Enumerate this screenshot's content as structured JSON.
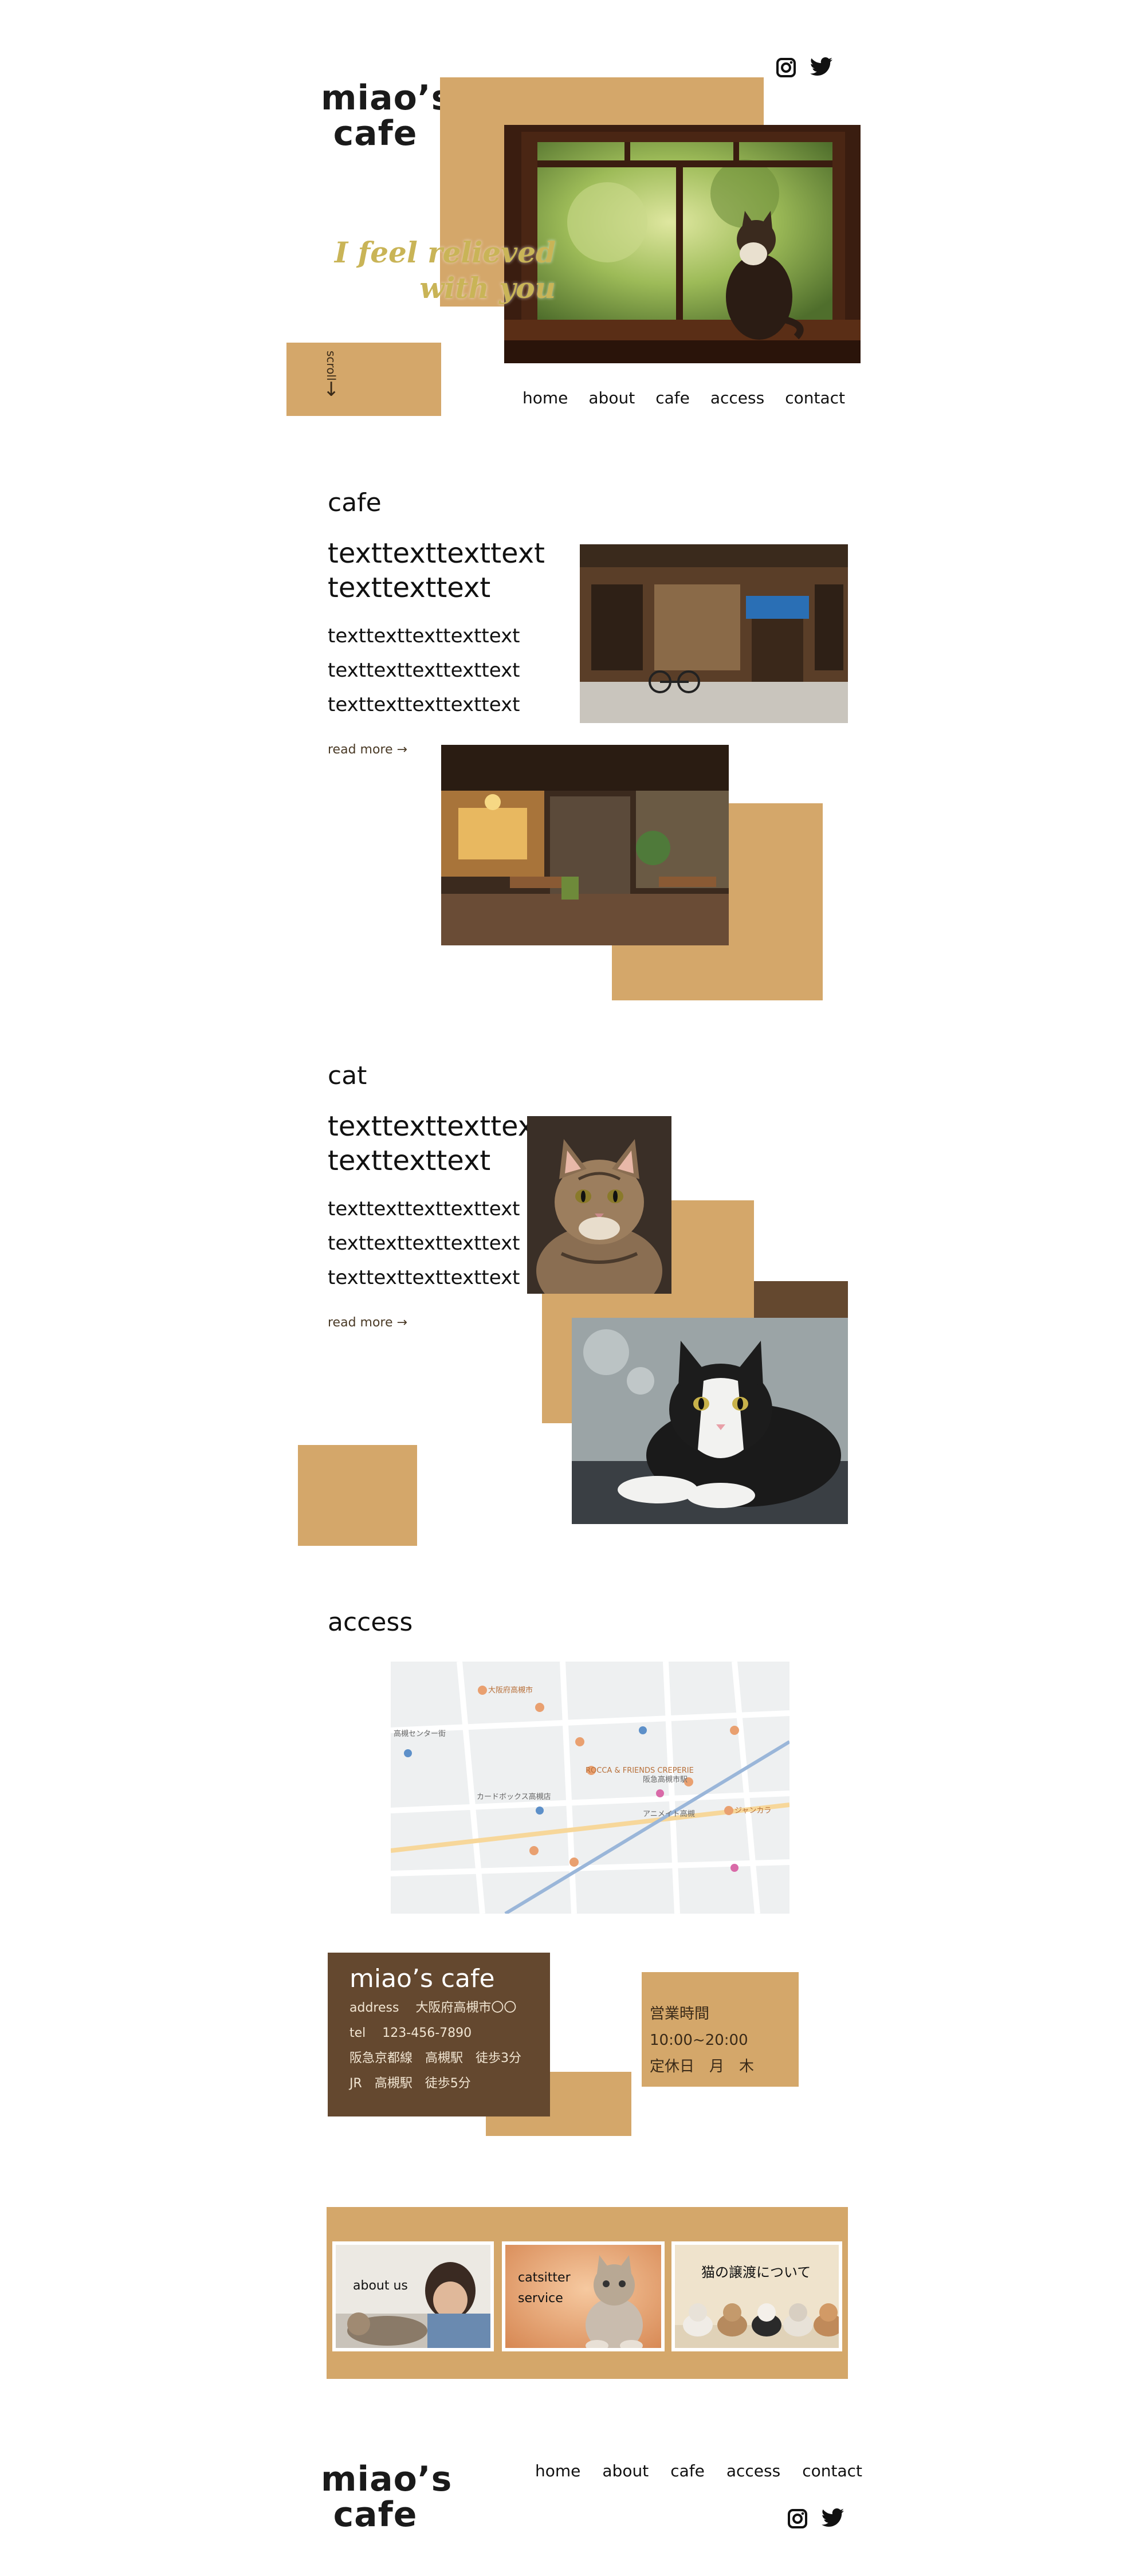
{
  "header": {
    "logo_line1": "miao’s",
    "logo_line2": "cafe",
    "tagline_line1": "I feel relieved",
    "tagline_line2": "with you",
    "scroll_label": "scroll",
    "scroll_arrow": "↓",
    "social": [
      "instagram-icon",
      "twitter-icon"
    ]
  },
  "nav": {
    "items": [
      "home",
      "about",
      "cafe",
      "access",
      "contact"
    ]
  },
  "cafe": {
    "title": "cafe",
    "lead": "texttexttexttext\n texttexttext",
    "body": [
      "texttexttexttexttext",
      "texttexttexttexttext",
      "texttexttexttexttext"
    ],
    "read_more": "read more →"
  },
  "cat": {
    "title": "cat",
    "lead": "texttexttexttext\n texttexttext",
    "body": [
      "texttexttexttexttext",
      "texttexttexttexttext",
      "texttexttexttexttext"
    ],
    "read_more": "read more →"
  },
  "access": {
    "title": "access",
    "map_labels": [
      "大阪府高槻市",
      "高槻センター街",
      "カードボックス高槻店",
      "ROCCA & FRIENDS CREPERIE",
      "ジャンカラ",
      "阪急高槻市駅",
      "アニメイト高槻"
    ],
    "card": {
      "name": "miao’s cafe",
      "address": "address　 大阪府高槻市〇〇",
      "tel": "tel　 123-456-7890",
      "route1": "阪急京都線　高槻駅　徒歩3分",
      "route2": "JR　高槻駅　徒歩5分"
    },
    "hours": {
      "open": "営業時間　10:00~20:00",
      "closed": "定休日　月　木"
    }
  },
  "banners": {
    "items": [
      {
        "label": "about us"
      },
      {
        "label": "catsitter\n service"
      },
      {
        "label": "猫の譲渡について"
      }
    ]
  },
  "footer": {
    "logo_line1": "miao’s",
    "logo_line2": "cafe",
    "nav": [
      "home",
      "about",
      "cafe",
      "access",
      "contact"
    ]
  },
  "colors": {
    "tan": "#d4a76a",
    "brown": "#64482f",
    "tagline": "#c9b457"
  }
}
